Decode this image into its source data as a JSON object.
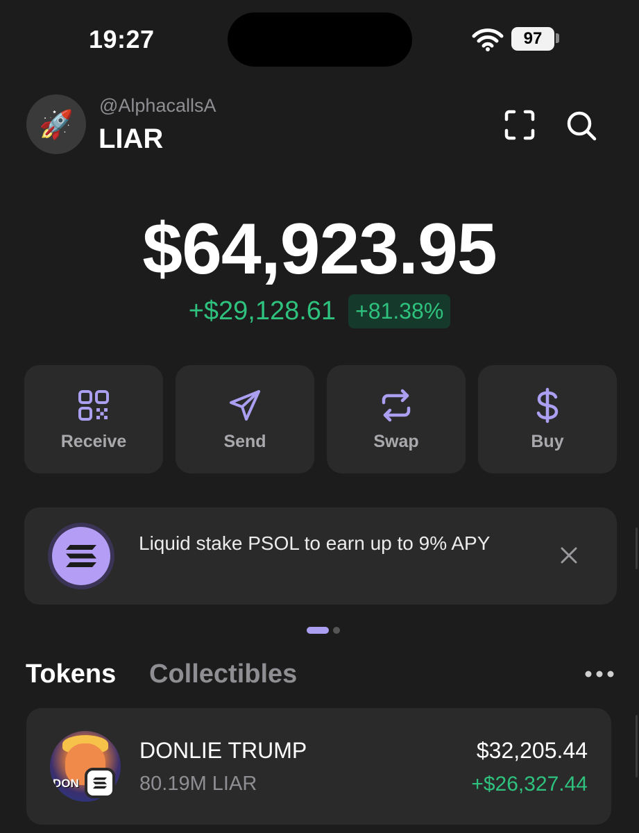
{
  "status_bar": {
    "time": "19:27",
    "battery": "97",
    "wifi_icon": "wifi-icon"
  },
  "header": {
    "avatar_icon": "rocket-icon",
    "handle": "@AlphacallsA",
    "account_name": "LIAR",
    "scan_icon": "scan-icon",
    "search_icon": "search-icon"
  },
  "balance": {
    "total": "$64,923.95",
    "change_abs": "+$29,128.61",
    "change_pct": "+81.38%"
  },
  "actions": [
    {
      "label": "Receive",
      "icon": "qr-code-icon"
    },
    {
      "label": "Send",
      "icon": "send-icon"
    },
    {
      "label": "Swap",
      "icon": "swap-icon"
    },
    {
      "label": "Buy",
      "icon": "dollar-icon"
    }
  ],
  "promo": {
    "text": "Liquid stake PSOL to earn up to 9% APY",
    "icon": "psol-logo-icon",
    "close_icon": "close-icon"
  },
  "tabs": [
    {
      "label": "Tokens",
      "active": true
    },
    {
      "label": "Collectibles",
      "active": false
    }
  ],
  "tokens": [
    {
      "name": "DONLIE TRUMP",
      "amount": "80.19M LIAR",
      "value": "$32,205.44",
      "change": "+$26,327.44",
      "image_text": "DON",
      "chain_icon": "solana-icon"
    }
  ],
  "colors": {
    "background": "#1c1c1c",
    "card": "#2a2a2a",
    "accent": "#ab9ff2",
    "positive": "#2ec27e",
    "muted": "#8e8e93"
  }
}
